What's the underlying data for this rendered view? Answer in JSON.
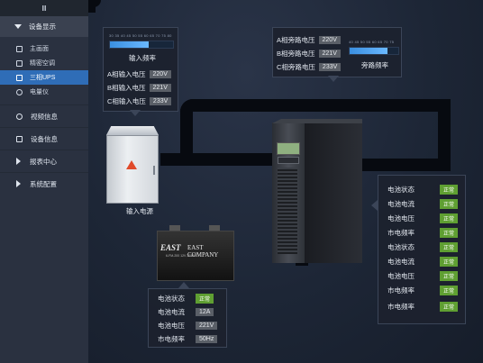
{
  "sidebar": {
    "top_icon": "Ⅲ",
    "group": "设备显示",
    "items": [
      {
        "label": "主画面",
        "icon": "grid-icon"
      },
      {
        "label": "精密空调",
        "icon": "ac-icon"
      },
      {
        "label": "三相UPS",
        "icon": "ups-icon",
        "active": true
      },
      {
        "label": "电量仪",
        "icon": "meter-icon"
      }
    ],
    "mains": [
      {
        "label": "视频信息",
        "icon": "video-icon"
      },
      {
        "label": "设备信息",
        "icon": "device-icon"
      },
      {
        "label": "报表中心",
        "icon": "report-icon"
      },
      {
        "label": "系统配置",
        "icon": "config-icon"
      }
    ]
  },
  "input_panel": {
    "scale": "30 35 40 45 50 55 60 65 70 75 80",
    "bar_fraction": 0.62,
    "title": "输入频率",
    "rows": [
      {
        "label": "A相输入电压",
        "value": "220V"
      },
      {
        "label": "B相输入电压",
        "value": "221V"
      },
      {
        "label": "C相输入电压",
        "value": "233V"
      }
    ]
  },
  "bypass_panel": {
    "rows": [
      {
        "label": "A相旁路电压",
        "value": "220V"
      },
      {
        "label": "B相旁路电压",
        "value": "221V"
      },
      {
        "label": "C相旁路电压",
        "value": "233V"
      }
    ],
    "scale": "40 45 50 55 60 65 70 75",
    "bar_fraction": 0.78,
    "title": "旁路频率"
  },
  "cabinet_label": "输入电源",
  "battery_box": {
    "brand": "EAST",
    "company": "EAST COMPANY",
    "spec": "6-FM-200  12V  200Ah"
  },
  "battery_panel": {
    "rows": [
      {
        "label": "电池状态",
        "value": "正常",
        "type": "ok"
      },
      {
        "label": "电池电流",
        "value": "12A"
      },
      {
        "label": "电池电压",
        "value": "221V"
      },
      {
        "label": "市电频率",
        "value": "50Hz"
      }
    ]
  },
  "ups_panel": {
    "rows": [
      {
        "label": "电池状态",
        "value": "正常"
      },
      {
        "label": "电池电流",
        "value": "正常"
      },
      {
        "label": "电池电压",
        "value": "正常"
      },
      {
        "label": "市电频率",
        "value": "正常"
      },
      {
        "label": "电池状态",
        "value": "正常"
      },
      {
        "label": "电池电流",
        "value": "正常"
      },
      {
        "label": "电池电压",
        "value": "正常"
      },
      {
        "label": "市电频率",
        "value": "正常"
      },
      {
        "label": "市电频率",
        "value": "正常"
      }
    ]
  },
  "colors": {
    "ok": "#5f9f32",
    "active": "#2f6db7",
    "bar": "#4aa3f0"
  }
}
